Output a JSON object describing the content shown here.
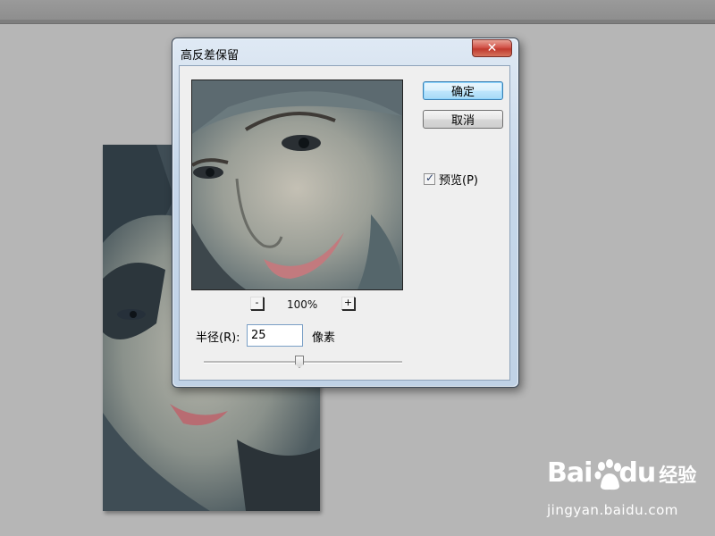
{
  "dialog": {
    "title": "高反差保留",
    "close_label": "✕",
    "ok_label": "确定",
    "cancel_label": "取消",
    "preview_checkbox": {
      "label": "预览(P)",
      "checked": true
    },
    "zoom": {
      "minus_label": "-",
      "plus_label": "+",
      "level": "100%"
    },
    "radius": {
      "label": "半径(R):",
      "value": "25",
      "unit": "像素",
      "slider_fraction": 0.5
    }
  },
  "watermark": {
    "logo": "Bai",
    "logo_tail": "du",
    "brand": "经验",
    "url": "jingyan.baidu.com"
  },
  "colors": {
    "workspace": "#b6b6b6",
    "dialog_frame": "#c6d7ea",
    "client": "#efefef",
    "close_button": "#c03a2e",
    "default_button": "#bee6fd"
  }
}
